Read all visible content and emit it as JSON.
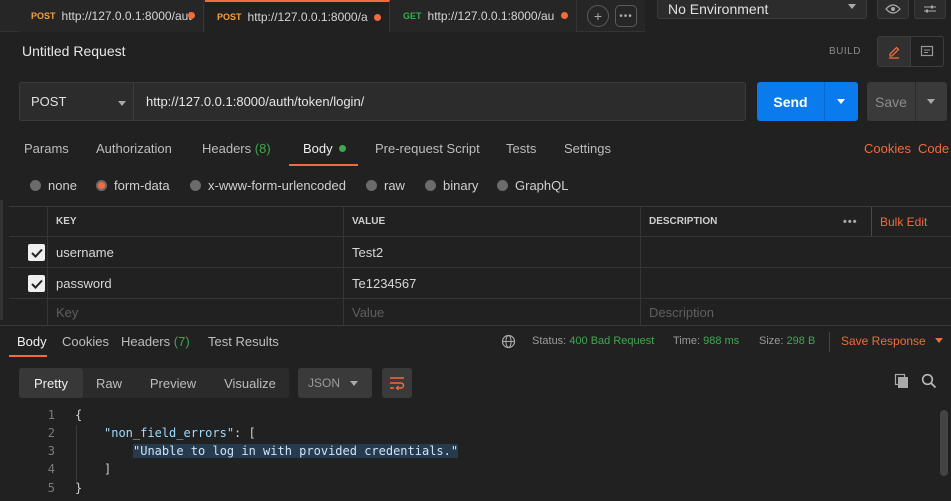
{
  "tabs": [
    {
      "method": "POST",
      "method_color": "#f8a13d",
      "url": "http://127.0.0.1:8000/aut"
    },
    {
      "method": "POST",
      "method_color": "#f8a13d",
      "url": "http://127.0.0.1:8000/a"
    },
    {
      "method": "GET",
      "method_color": "#3ea84f",
      "url": "http://127.0.0.1:8000/au"
    }
  ],
  "environment": {
    "selected": "No Environment"
  },
  "request": {
    "title": "Untitled Request",
    "mode_label": "BUILD",
    "method": "POST",
    "url": "http://127.0.0.1:8000/auth/token/login/",
    "send_label": "Send",
    "save_label": "Save"
  },
  "request_tabs": {
    "params": "Params",
    "authorization": "Authorization",
    "headers": "Headers",
    "headers_count": "(8)",
    "body": "Body",
    "prerequest": "Pre-request Script",
    "tests": "Tests",
    "settings": "Settings",
    "cookies": "Cookies",
    "code": "Code"
  },
  "body_types": {
    "none": "none",
    "form_data": "form-data",
    "urlencoded": "x-www-form-urlencoded",
    "raw": "raw",
    "binary": "binary",
    "graphql": "GraphQL",
    "selected": "form-data"
  },
  "params_table": {
    "col_key": "KEY",
    "col_value": "VALUE",
    "col_description": "DESCRIPTION",
    "more": "•••",
    "bulk_edit": "Bulk Edit",
    "rows": [
      {
        "key": "username",
        "value": "Test2",
        "description": "",
        "checked": true
      },
      {
        "key": "password",
        "value": "Te1234567",
        "description": "",
        "checked": true
      }
    ],
    "placeholder": {
      "key": "Key",
      "value": "Value",
      "description": "Description"
    }
  },
  "response": {
    "tabs": {
      "body": "Body",
      "cookies": "Cookies",
      "headers": "Headers",
      "headers_count": "(7)",
      "test_results": "Test Results"
    },
    "status_label": "Status:",
    "status_value": "400 Bad Request",
    "time_label": "Time:",
    "time_value": "988 ms",
    "size_label": "Size:",
    "size_value": "298 B",
    "save_response": "Save Response",
    "formats": {
      "pretty": "Pretty",
      "raw": "Raw",
      "preview": "Preview",
      "visualize": "Visualize",
      "language": "JSON"
    },
    "code_lines": [
      {
        "n": "1",
        "text": "{"
      },
      {
        "n": "2",
        "key": "\"non_field_errors\"",
        "rest": ": ["
      },
      {
        "n": "3",
        "str": "\"Unable to log in with provided credentials.\""
      },
      {
        "n": "4",
        "text": "]"
      },
      {
        "n": "5",
        "text": "}"
      }
    ]
  },
  "colors": {
    "accent": "#f26b3a",
    "send": "#097bed",
    "success": "#3ea84f"
  }
}
